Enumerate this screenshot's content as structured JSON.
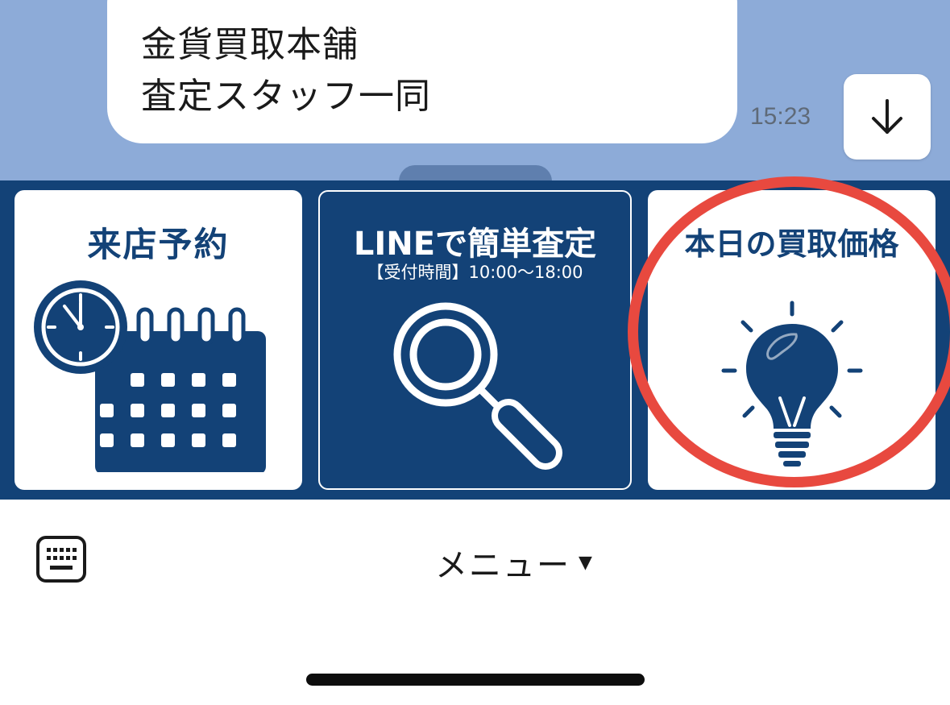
{
  "chat": {
    "message_lines": [
      "金貨買取本舗",
      "査定スタッフ一同"
    ],
    "timestamp": "15:23",
    "scroll_down_icon": "arrow-down-icon"
  },
  "rich_menu": {
    "tiles": [
      {
        "title": "来店予約",
        "icon": "calendar-clock-icon"
      },
      {
        "title": "LINEで簡単査定",
        "subtitle": "【受付時間】10:00〜18:00",
        "icon": "magnifier-icon"
      },
      {
        "title": "本日の買取価格",
        "icon": "lightbulb-icon"
      }
    ]
  },
  "bottom_bar": {
    "keyboard_icon": "keyboard-icon",
    "menu_label": "メニュー",
    "menu_caret": "▼"
  },
  "colors": {
    "chat_background": "#8dabd8",
    "brand_navy": "#134277",
    "highlight_red": "#e8493f",
    "text_dark": "#1a1a1a",
    "timestamp_gray": "#5f6a78"
  }
}
